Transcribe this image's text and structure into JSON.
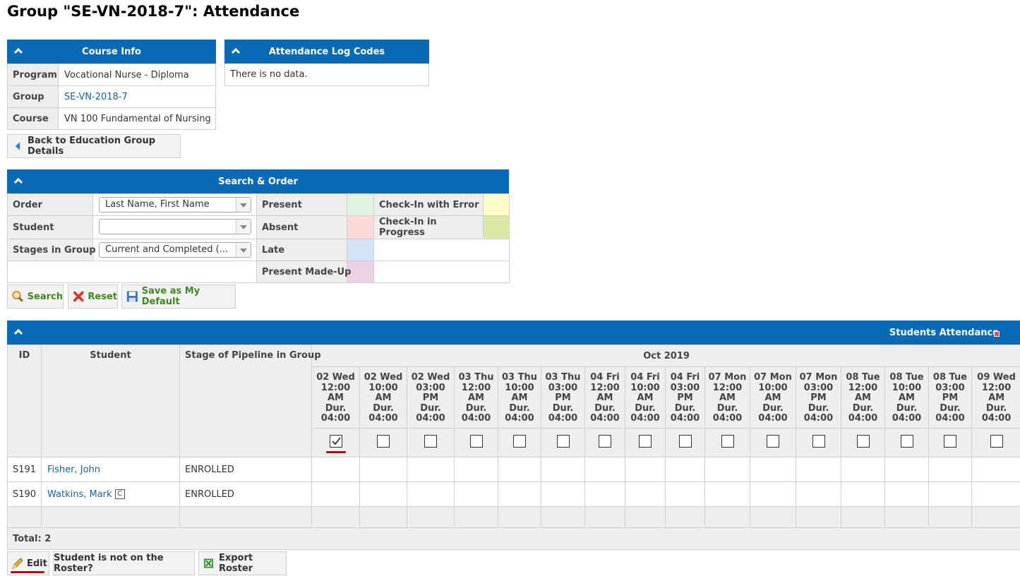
{
  "page": {
    "title": "Group \"SE-VN-2018-7\": Attendance"
  },
  "course_info": {
    "title": "Course Info",
    "rows": [
      {
        "label": "Program",
        "value": "Vocational Nurse - Diploma"
      },
      {
        "label": "Group",
        "value": "SE-VN-2018-7"
      },
      {
        "label": "Course",
        "value": "VN 100 Fundamental of Nursing"
      }
    ]
  },
  "log_codes": {
    "title": "Attendance Log Codes",
    "empty": "There is no data."
  },
  "back_button": "Back to Education Group Details",
  "search": {
    "title": "Search & Order",
    "order_label": "Order",
    "order_value": "Last Name, First Name",
    "student_label": "Student",
    "student_value": "",
    "stages_label": "Stages in Group",
    "stages_value": "Current and Completed (...",
    "legend": [
      {
        "label": "Present",
        "color": "#e2f2e2"
      },
      {
        "label": "Check-In with Error",
        "color": "#fefecd"
      },
      {
        "label": "Absent",
        "color": "#fcd9d9"
      },
      {
        "label": "Check-In in Progress",
        "color": "#dbe9a8"
      },
      {
        "label": "Late",
        "color": "#d5e4f4"
      },
      {
        "label": "Present Made-Up",
        "color": "#ecd0e4"
      }
    ],
    "search_btn": "Search",
    "reset_btn": "Reset",
    "default_btn": "Save as My Default"
  },
  "attendance": {
    "title": "Students Attendance",
    "col_id": "ID",
    "col_student": "Student",
    "col_stage": "Stage of Pipeline in Group",
    "month": "Oct 2019",
    "dates": [
      {
        "l1": "02 Wed",
        "l2": "12:00",
        "l3": "AM",
        "l4": "Dur.",
        "l5": "04:00",
        "checked": true
      },
      {
        "l1": "02 Wed",
        "l2": "10:00",
        "l3": "AM",
        "l4": "Dur.",
        "l5": "04:00",
        "checked": false
      },
      {
        "l1": "02 Wed",
        "l2": "03:00",
        "l3": "PM",
        "l4": "Dur.",
        "l5": "04:00",
        "checked": false
      },
      {
        "l1": "03 Thu",
        "l2": "12:00",
        "l3": "AM",
        "l4": "Dur.",
        "l5": "04:00",
        "checked": false
      },
      {
        "l1": "03 Thu",
        "l2": "10:00",
        "l3": "AM",
        "l4": "Dur.",
        "l5": "04:00",
        "checked": false
      },
      {
        "l1": "03 Thu",
        "l2": "03:00",
        "l3": "PM",
        "l4": "Dur.",
        "l5": "04:00",
        "checked": false
      },
      {
        "l1": "04 Fri",
        "l2": "12:00",
        "l3": "AM",
        "l4": "Dur.",
        "l5": "04:00",
        "checked": false
      },
      {
        "l1": "04 Fri",
        "l2": "10:00",
        "l3": "AM",
        "l4": "Dur.",
        "l5": "04:00",
        "checked": false
      },
      {
        "l1": "04 Fri",
        "l2": "03:00",
        "l3": "PM",
        "l4": "Dur.",
        "l5": "04:00",
        "checked": false
      },
      {
        "l1": "07 Mon",
        "l2": "12:00",
        "l3": "AM",
        "l4": "Dur.",
        "l5": "04:00",
        "checked": false
      },
      {
        "l1": "07 Mon",
        "l2": "10:00",
        "l3": "AM",
        "l4": "Dur.",
        "l5": "04:00",
        "checked": false
      },
      {
        "l1": "07 Mon",
        "l2": "03:00",
        "l3": "PM",
        "l4": "Dur.",
        "l5": "04:00",
        "checked": false
      },
      {
        "l1": "08 Tue",
        "l2": "12:00",
        "l3": "AM",
        "l4": "Dur.",
        "l5": "04:00",
        "checked": false
      },
      {
        "l1": "08 Tue",
        "l2": "10:00",
        "l3": "AM",
        "l4": "Dur.",
        "l5": "04:00",
        "checked": false
      },
      {
        "l1": "08 Tue",
        "l2": "03:00",
        "l3": "PM",
        "l4": "Dur.",
        "l5": "04:00",
        "checked": false
      },
      {
        "l1": "09 Wed",
        "l2": "12:00",
        "l3": "AM",
        "l4": "Dur.",
        "l5": "04:00",
        "checked": false
      }
    ],
    "students": [
      {
        "id": "S191",
        "name": "Fisher, John",
        "stage": "ENROLLED",
        "badge": ""
      },
      {
        "id": "S190",
        "name": "Watkins, Mark",
        "stage": "ENROLLED",
        "badge": "C"
      }
    ],
    "total": "Total: 2"
  },
  "bottom": {
    "edit": "Edit",
    "not_on_roster": "Student is not on the Roster?",
    "export": "Export Roster"
  },
  "colors": {
    "header_blue": "#0a6ab5",
    "underline_red": "#d00000"
  }
}
